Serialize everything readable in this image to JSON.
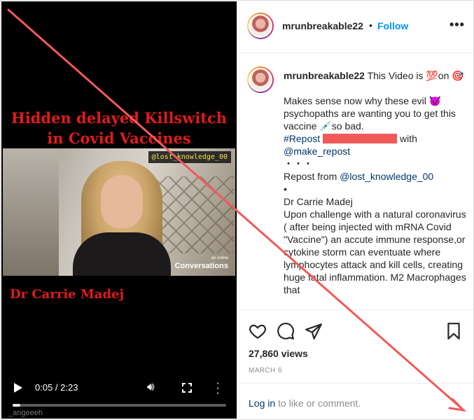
{
  "video": {
    "headline_line1": "Hidden delayed Killswitch",
    "headline_line2": "in Covid Vaccines",
    "watermark": "@lost_knowledge_00",
    "brand": "Conversations",
    "brand_small": "an online",
    "caption": "Dr Carrie Madej",
    "time": "0:05 / 2:23",
    "progress": 0.035,
    "uploader": "_angeeeh"
  },
  "header": {
    "username": "mrunbreakable22",
    "dot": "•",
    "follow": "Follow",
    "menu": "•••"
  },
  "comment": {
    "username": "mrunbreakable22",
    "intro": "This Video is 💯on 🎯",
    "p1": "Makes sense now why these evil 👿 psychopaths are wanting you to get this vaccine 💉so bad.",
    "repost_tag": "#Repost",
    "with": "with",
    "make_repost": "@make_repost",
    "dots1": "・・・",
    "repost_from": "Repost from",
    "repost_user": "@lost_knowledge_00",
    "dots2": "•",
    "name": "Dr Carrie Madej",
    "body": "Upon challenge with a natural coronavirus ( after being injected with mRNA Covid \"Vaccine\") an accute immune response,or cytokine storm can eventuate where lymphocytes attack and kill cells, creating huge fatal inflammation. M2 Macrophages that"
  },
  "actions": {
    "views": "27,860 views",
    "date": "MARCH 6",
    "login_link": "Log in",
    "login_rest": " to like or comment."
  },
  "colors": {
    "accent": "#0095f6",
    "red_text": "#e01b1b",
    "overlay_line": "#f05a5a"
  }
}
